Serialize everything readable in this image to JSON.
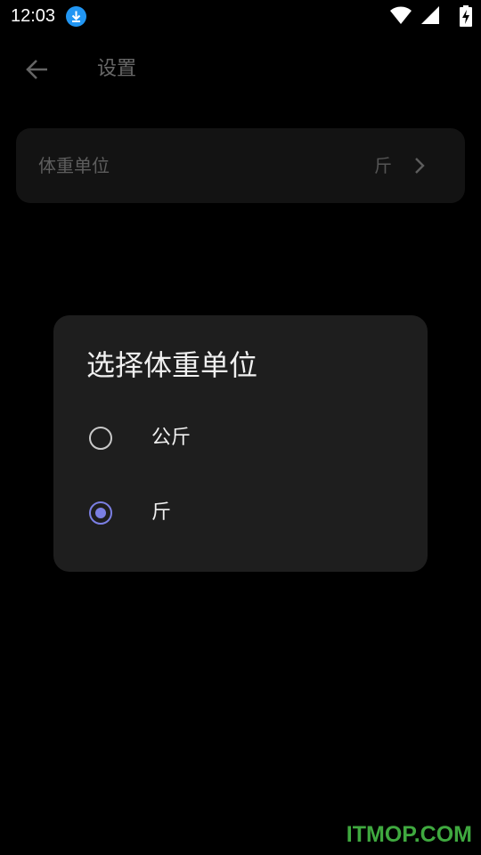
{
  "status_bar": {
    "time": "12:03",
    "icons": [
      "download-icon",
      "wifi-icon",
      "signal-icon",
      "battery-charging-icon"
    ]
  },
  "toolbar": {
    "back_icon": "arrow-left-icon",
    "title": "设置"
  },
  "settings": {
    "weight_unit": {
      "label": "体重单位",
      "value": "斤"
    }
  },
  "dialog": {
    "title": "选择体重单位",
    "options": [
      {
        "label": "公斤",
        "selected": false
      },
      {
        "label": "斤",
        "selected": true
      }
    ],
    "accent_color": "#7b7fe3"
  },
  "watermark": "ITMOP.COM"
}
